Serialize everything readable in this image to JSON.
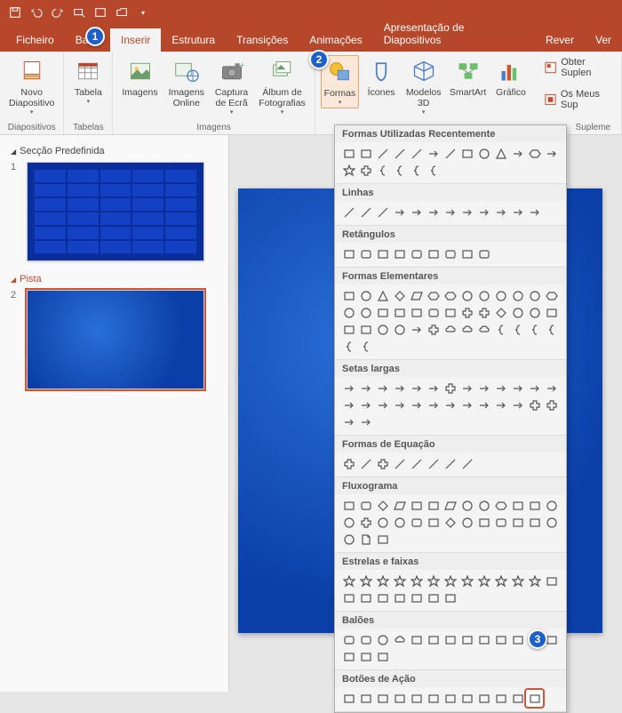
{
  "tabs": {
    "file": "Ficheiro",
    "home": "Base",
    "insert": "Inserir",
    "design": "Estrutura",
    "transitions": "Transições",
    "animations": "Animações",
    "slideshow": "Apresentação de Diapositivos",
    "review": "Rever",
    "view": "Ver"
  },
  "ribbon": {
    "new_slide": "Novo\nDiapositivo",
    "slides_group": "Diapositivos",
    "table": "Tabela",
    "tables_group": "Tabelas",
    "images": "Imagens",
    "images_online": "Imagens\nOnline",
    "screenshot": "Captura\nde Ecrã",
    "photo_album": "Álbum de\nFotografias",
    "images_group": "Imagens",
    "shapes": "Formas",
    "icons": "Ícones",
    "models3d": "Modelos\n3D",
    "smartart": "SmartArt",
    "chart": "Gráfico",
    "addins1": "Obter Suplen",
    "addins2": "Os Meus Sup",
    "addins_group": "Supleme"
  },
  "sections": {
    "default": "Secção Predefinida",
    "pista": "Pista"
  },
  "shapes_menu": {
    "recent": "Formas Utilizadas Recentemente",
    "lines": "Linhas",
    "rectangles": "Retângulos",
    "basic": "Formas Elementares",
    "arrows": "Setas largas",
    "equation": "Formas de Equação",
    "flowchart": "Fluxograma",
    "stars": "Estrelas e faixas",
    "callouts": "Balões",
    "action": "Botões de Ação"
  },
  "callouts": {
    "c1": "1",
    "c2": "2",
    "c3": "3"
  }
}
